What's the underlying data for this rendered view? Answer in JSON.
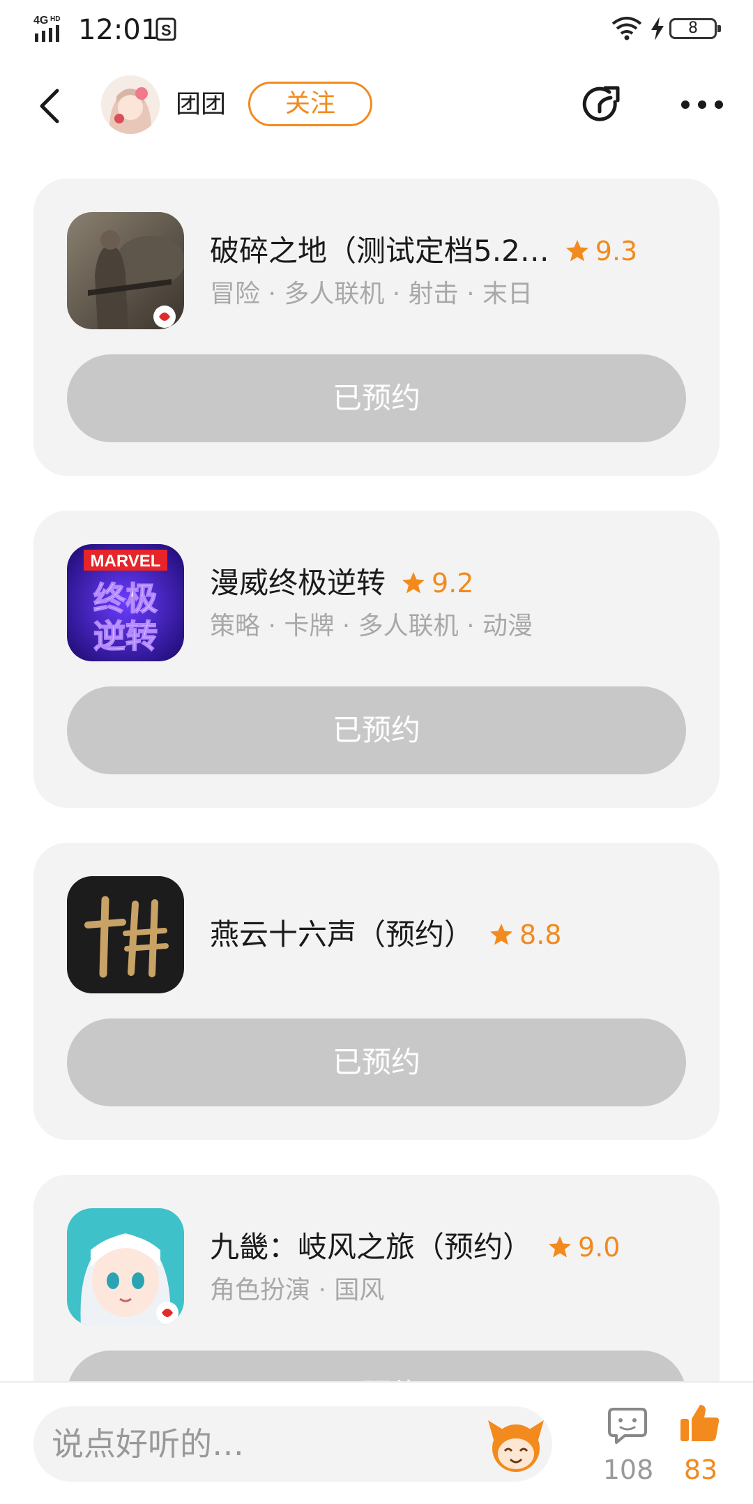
{
  "status_bar": {
    "network": "4G HD",
    "time": "12:01",
    "battery": "8"
  },
  "header": {
    "username": "团团",
    "follow_label": "关注"
  },
  "colors": {
    "accent": "#f28a1e",
    "card_bg": "#f3f3f3",
    "button_disabled": "#c8c8c8",
    "tag_text": "#a8a8a8"
  },
  "games": [
    {
      "title": "破碎之地（测试定档5.2…",
      "rating": "9.3",
      "tags": "冒险 · 多人联机 · 射击 · 末日",
      "button_label": "已预约",
      "icon": "soldier-game-icon"
    },
    {
      "title": "漫威终极逆转",
      "rating": "9.2",
      "tags": "策略 · 卡牌 · 多人联机 · 动漫",
      "button_label": "已预约",
      "icon": "marvel-game-icon",
      "icon_text_top": "MARVEL",
      "icon_text_main": "终极逆转"
    },
    {
      "title": "燕云十六声（预约）",
      "rating": "8.8",
      "tags": "",
      "button_label": "已预约",
      "icon": "yanyun-game-icon",
      "icon_text": "十六"
    },
    {
      "title": "九畿：岐风之旅（预约）",
      "rating": "9.0",
      "tags": "角色扮演 · 国风",
      "button_label": "已预约",
      "icon": "anime-girl-game-icon"
    }
  ],
  "bottom_bar": {
    "placeholder": "说点好听的…",
    "comment_count": "108",
    "like_count": "83"
  }
}
